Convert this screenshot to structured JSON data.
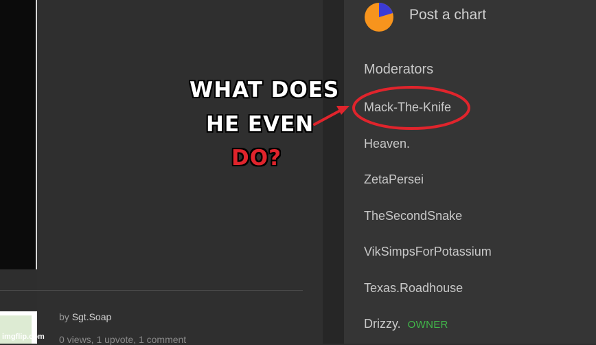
{
  "sidebar": {
    "post_chart_label": "Post a chart",
    "moderators_title": "Moderators",
    "moderators": [
      {
        "name": "Mack-The-Knife"
      },
      {
        "name": "Heaven."
      },
      {
        "name": "ZetaPersei"
      },
      {
        "name": "TheSecondSnake"
      },
      {
        "name": "VikSimpsForPotassium"
      },
      {
        "name": "Texas.Roadhouse"
      },
      {
        "name": "Drizzy.",
        "badge": "OWNER"
      }
    ]
  },
  "caption": {
    "line1": "WHAT DOES",
    "line2": "HE EVEN",
    "line3": "DO?"
  },
  "post": {
    "by": "by",
    "author": "Sgt.Soap",
    "stats": "0 views, 1 upvote, 1 comment"
  },
  "watermark": "imgflip.com",
  "colors": {
    "background": "#2e2e2e",
    "sidebar": "#353535",
    "text": "#c8c8c8",
    "owner": "#41b84a",
    "annotation": "#e0242c",
    "chart_icon_orange": "#f7941d",
    "chart_icon_blue": "#3b3bd6"
  },
  "icons": {
    "chart": "pie-chart-icon"
  }
}
